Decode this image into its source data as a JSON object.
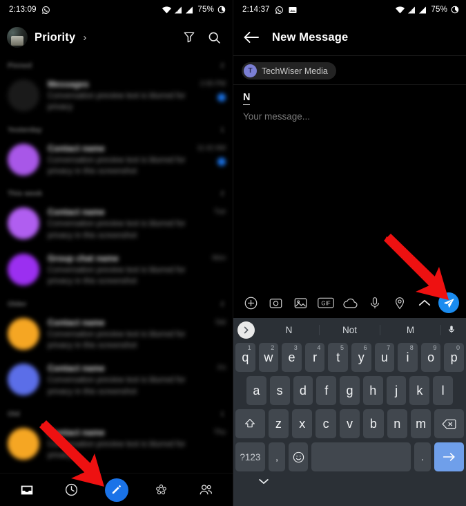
{
  "left": {
    "statusbar": {
      "time": "2:13:09",
      "battery_pct": "75%",
      "icons": [
        "whatsapp-icon",
        "wifi-icon",
        "signal-icon",
        "signal-icon",
        "battery-icon"
      ]
    },
    "header": {
      "title": "Priority",
      "chevron": "›",
      "filter_icon": "filter-icon",
      "search_icon": "search-icon",
      "avatar": "profile-avatar"
    },
    "sections": [
      {
        "label": "Pinned",
        "count": "2",
        "rows": [
          {
            "name": "Messages",
            "snippet": "Conversation preview text is blurred for privacy",
            "time": "2:05 PM",
            "avatar_color": "#1a1a1a",
            "unread": true
          }
        ]
      },
      {
        "label": "Yesterday",
        "count": "1",
        "rows": [
          {
            "name": "Contact name",
            "snippet": "Conversation preview text is blurred for privacy in this screenshot",
            "time": "11:42 AM",
            "avatar_color": "#a857e8",
            "unread": true
          }
        ]
      },
      {
        "label": "This week",
        "count": "2",
        "rows": [
          {
            "name": "Contact name",
            "snippet": "Conversation preview text is blurred for privacy in this screenshot",
            "time": "Tue",
            "avatar_color": "#b05ef0",
            "unread": false
          },
          {
            "name": "Group chat name",
            "snippet": "Conversation preview text is blurred for privacy in this screenshot",
            "time": "Mon",
            "avatar_color": "#9b2ff0",
            "unread": false
          }
        ]
      },
      {
        "label": "Older",
        "count": "2",
        "rows": [
          {
            "name": "Contact name",
            "snippet": "Conversation preview text is blurred for privacy in this screenshot",
            "time": "Sat",
            "avatar_color": "#f5a623",
            "unread": false
          },
          {
            "name": "Contact name",
            "snippet": "Conversation preview text is blurred for privacy in this screenshot",
            "time": "Fri",
            "avatar_color": "#5b6ee8",
            "unread": false
          }
        ]
      },
      {
        "label": "Old",
        "count": "1",
        "rows": [
          {
            "name": "Contact name",
            "snippet": "Conversation preview text is blurred for privacy",
            "time": "Thu",
            "avatar_color": "#f5a623",
            "unread": false
          }
        ]
      }
    ],
    "bottomnav": {
      "items": [
        {
          "name": "inbox-icon",
          "label": "Inbox",
          "active": true
        },
        {
          "name": "clock-icon",
          "label": "Scheduled",
          "active": false
        },
        {
          "name": "compose-pencil-icon",
          "label": "Compose",
          "active": false
        },
        {
          "name": "hub-icon",
          "label": "Hub",
          "active": false
        },
        {
          "name": "people-icon",
          "label": "Contacts",
          "active": false
        }
      ]
    }
  },
  "right": {
    "statusbar": {
      "time": "2:14:37",
      "battery_pct": "75%",
      "icons": [
        "whatsapp-icon",
        "image-icon",
        "wifi-icon",
        "signal-icon",
        "signal-icon",
        "battery-icon"
      ]
    },
    "header": {
      "back_icon": "back-arrow-icon",
      "title": "New Message"
    },
    "recipient": {
      "initial": "T",
      "name": "TechWiser Media"
    },
    "compose": {
      "typed_text": "N",
      "placeholder": "Your message..."
    },
    "attachbar": {
      "items": [
        {
          "name": "plus-icon",
          "label": "Add"
        },
        {
          "name": "camera-icon",
          "label": "Camera"
        },
        {
          "name": "gallery-icon",
          "label": "Gallery"
        },
        {
          "name": "gif-icon",
          "label": "GIF"
        },
        {
          "name": "cloud-icon",
          "label": "Cloud"
        },
        {
          "name": "microphone-icon",
          "label": "Voice"
        },
        {
          "name": "location-icon",
          "label": "Location"
        },
        {
          "name": "chevron-up-icon",
          "label": "More"
        }
      ],
      "send": {
        "name": "send-paper-plane-icon",
        "label": "Send",
        "color": "#1a8cf0"
      }
    },
    "keyboard": {
      "suggestions": [
        "N",
        "Not",
        "M"
      ],
      "expand_icon": "chevron-right-icon",
      "mic_icon": "microphone-icon",
      "row1": [
        {
          "k": "q",
          "n": "1"
        },
        {
          "k": "w",
          "n": "2"
        },
        {
          "k": "e",
          "n": "3"
        },
        {
          "k": "r",
          "n": "4"
        },
        {
          "k": "t",
          "n": "5"
        },
        {
          "k": "y",
          "n": "6"
        },
        {
          "k": "u",
          "n": "7"
        },
        {
          "k": "i",
          "n": "8"
        },
        {
          "k": "o",
          "n": "9"
        },
        {
          "k": "p",
          "n": "0"
        }
      ],
      "row2": [
        "a",
        "s",
        "d",
        "f",
        "g",
        "h",
        "j",
        "k",
        "l"
      ],
      "row3": [
        "z",
        "x",
        "c",
        "v",
        "b",
        "n",
        "m"
      ],
      "shift_icon": "shift-icon",
      "backspace_icon": "backspace-icon",
      "symbols_key": "?123",
      "comma_key": ",",
      "emoji_icon": "emoji-icon",
      "space_key": "",
      "period_key": ".",
      "enter_icon": "enter-arrow-icon",
      "hide_keyboard_icon": "chevron-down-icon"
    }
  },
  "annotations": {
    "arrow_color": "#ee1111",
    "arrows": [
      {
        "name": "arrow-to-compose-button",
        "target": "compose-pencil-icon"
      },
      {
        "name": "arrow-to-send-button",
        "target": "send-paper-plane-icon"
      }
    ]
  }
}
